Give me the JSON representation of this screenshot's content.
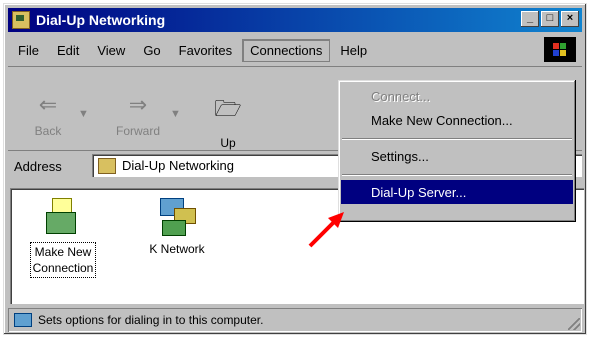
{
  "window": {
    "title": "Dial-Up Networking"
  },
  "title_buttons": [
    "_",
    "□",
    "×"
  ],
  "menubar": [
    "File",
    "Edit",
    "View",
    "Go",
    "Favorites",
    "Connections",
    "Help"
  ],
  "toolbar": {
    "back": "Back",
    "forward": "Forward",
    "up": "Up"
  },
  "address": {
    "label": "Address",
    "value": "Dial-Up Networking"
  },
  "items": [
    {
      "label_line1": "Make New",
      "label_line2": "Connection"
    },
    {
      "label": "K Network"
    }
  ],
  "connections_menu": [
    {
      "label": "Connect...",
      "state": "disabled"
    },
    {
      "label": "Make New Connection...",
      "state": "enabled"
    },
    {
      "label": "Settings...",
      "state": "enabled"
    },
    {
      "label": "Dial-Up Server...",
      "state": "highlighted"
    }
  ],
  "status": {
    "text": "Sets options for dialing in to this computer."
  },
  "colors": {
    "titlebar": "#000080",
    "highlight": "#000080",
    "arrow": "#ff0000",
    "chrome": "#c0c0c0"
  },
  "icons": [
    "dialup-folder-icon",
    "back-arrow-icon",
    "forward-arrow-icon",
    "up-folder-icon",
    "windows-logo-icon",
    "make-new-connection-icon",
    "network-connection-icon",
    "status-computer-icon",
    "red-pointer-arrow-icon"
  ]
}
